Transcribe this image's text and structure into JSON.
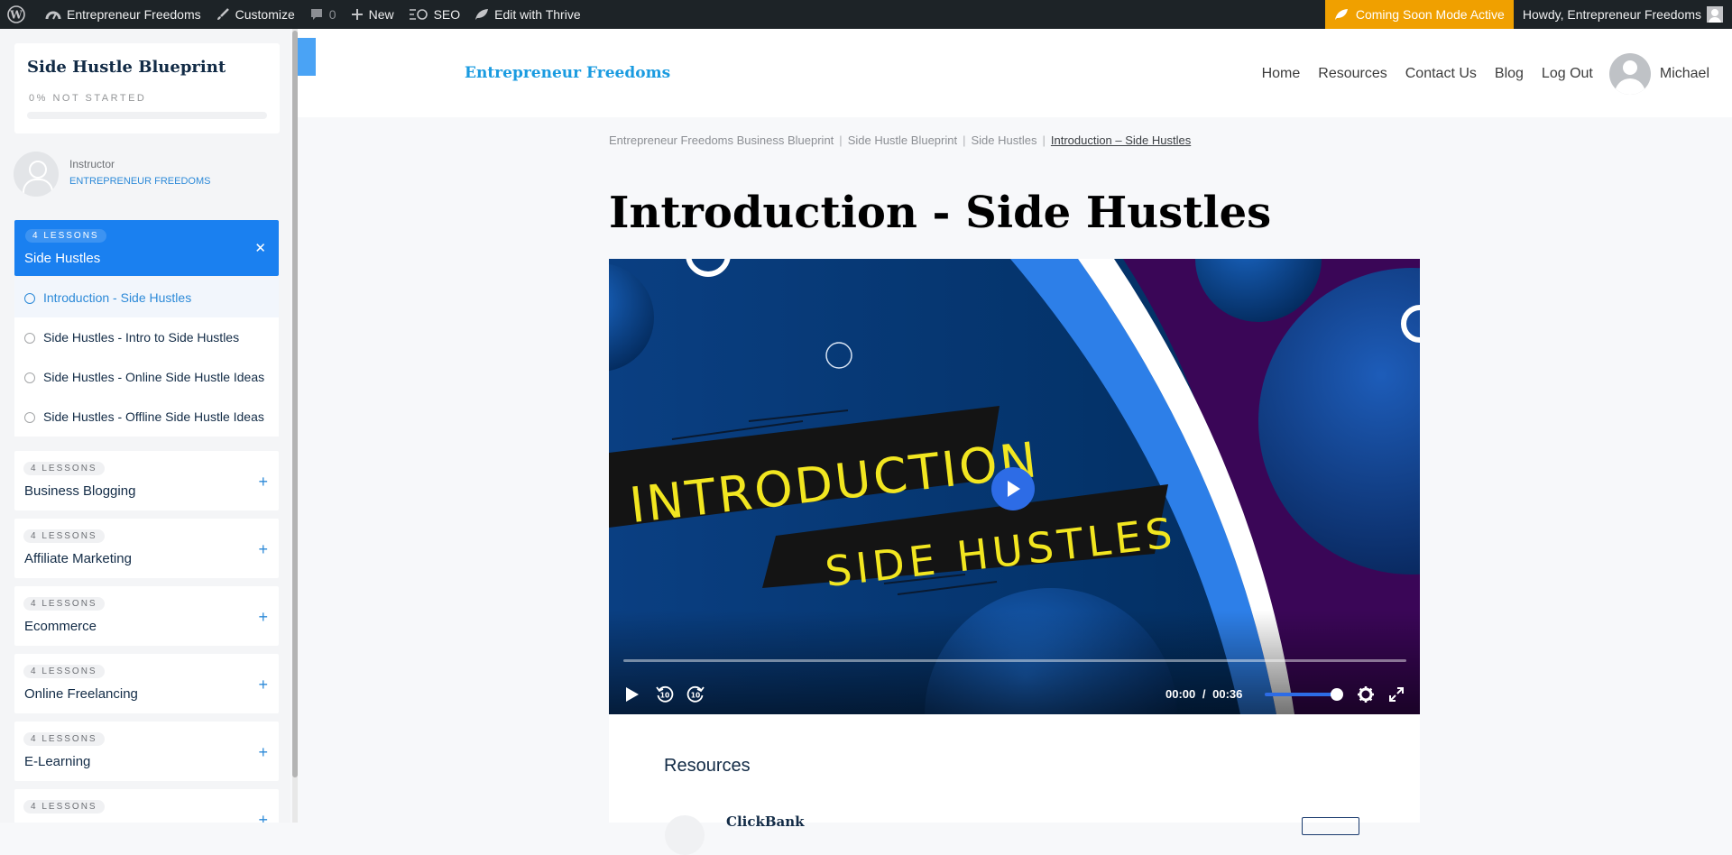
{
  "admin_bar": {
    "site_name": "Entrepreneur Freedoms",
    "customize": "Customize",
    "comments": "0",
    "new": "New",
    "seo": "SEO",
    "edit_thrive": "Edit with Thrive",
    "coming_soon": "Coming Soon Mode Active",
    "howdy": "Howdy, Entrepreneur Freedoms"
  },
  "sidebar": {
    "course_title": "Side Hustle Blueprint",
    "course_status": "0% NOT STARTED",
    "course_progress": 0,
    "instructor_label": "Instructor",
    "instructor_name": "ENTREPRENEUR FREEDOMS",
    "active_section": {
      "badge": "4 LESSONS",
      "title": "Side Hustles",
      "lessons": [
        {
          "label": "Introduction - Side Hustles"
        },
        {
          "label": "Side Hustles - Intro to Side Hustles"
        },
        {
          "label": "Side Hustles - Online Side Hustle Ideas"
        },
        {
          "label": "Side Hustles - Offline Side Hustle Ideas"
        }
      ]
    },
    "sections": [
      {
        "badge": "4 LESSONS",
        "title": "Business Blogging"
      },
      {
        "badge": "4 LESSONS",
        "title": "Affiliate Marketing"
      },
      {
        "badge": "4 LESSONS",
        "title": "Ecommerce"
      },
      {
        "badge": "4 LESSONS",
        "title": "Online Freelancing"
      },
      {
        "badge": "4 LESSONS",
        "title": "E-Learning"
      },
      {
        "badge": "4 LESSONS",
        "title": ""
      }
    ]
  },
  "header": {
    "logo": "Entrepreneur Freedoms",
    "nav": [
      "Home",
      "Resources",
      "Contact Us",
      "Blog",
      "Log Out"
    ],
    "user": "Michael"
  },
  "breadcrumb": [
    "Entrepreneur Freedoms Business Blueprint",
    "Side Hustle Blueprint",
    "Side Hustles",
    "Introduction – Side Hustles"
  ],
  "page_title": "Introduction - Side Hustles",
  "video": {
    "line1": "INTRODUCTION",
    "line2": "SIDE HUSTLES",
    "current_time": "00:00",
    "duration": "00:36",
    "progress": 0,
    "volume": 1,
    "colors": {
      "accent": "#2d6ce6",
      "bg": "#07356d",
      "purple": "#3a0657",
      "yellow": "#f2e620"
    }
  },
  "resources": {
    "title": "Resources",
    "first_item": "ClickBank"
  }
}
